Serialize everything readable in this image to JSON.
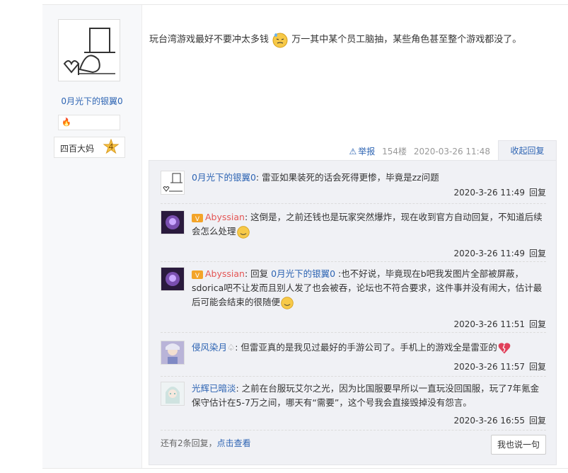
{
  "author": {
    "name": "0月光下的银翼0",
    "level_title": "四百大妈",
    "level_num": "4"
  },
  "post": {
    "text_before": "玩台湾游戏最好不要冲太多钱",
    "text_after": "万一其中某个员工脑抽，某些角色甚至整个游戏都没了。"
  },
  "tail": {
    "report": "举报",
    "floor": "154楼",
    "time": "2020-03-26 11:48",
    "collapse": "收起回复"
  },
  "replies": [
    {
      "user": "0月光下的银翼0",
      "text": ": 雷亚如果装死的话会死得更惨，毕竟是zz问题",
      "time": "2020-3-26 11:49",
      "reply": "回复"
    },
    {
      "user": "Abyssian",
      "text": ": 这倒是，之前还钱也是玩家突然爆炸，现在收到官方自动回复，不知道后续会怎么处理",
      "time": "2020-3-26 11:49",
      "reply": "回复"
    },
    {
      "user": "Abyssian",
      "reply_prefix": ": 回复 ",
      "reply_to": "0月光下的银翼0",
      "text": " :也不好说，毕竟现在b吧我发图片全部被屏蔽，sdorica吧不让发而且别人发了也会被吞，论坛也不符合要求，这件事并没有闹大，估计最后可能会结束的很随便",
      "time": "2020-3-26 11:51",
      "reply": "回复"
    },
    {
      "user": "侵风染月",
      "user_suffix": "♤",
      "text": ": 但雷亚真的是我见过最好的手游公司了。手机上的游戏全是雷亚的",
      "time": "2020-3-26 11:57",
      "reply": "回复"
    },
    {
      "user": "光辉已暗淡",
      "text": ": 之前在台服玩艾尔之光，因为比国服要早所以一直玩没回国服，玩了7年氪金保守估计在5-7万之间，哪天有“需要”，这个号我会直接毁掉没有怨言。",
      "time": "2020-3-26 16:55",
      "reply": "回复"
    }
  ],
  "footer": {
    "more_prefix": "还有2条回复，",
    "more_link": "点击查看",
    "reply_button": "我也说一句"
  },
  "colors": {
    "link": "#2d64b3",
    "vip_name": "#e45554",
    "panel_bg": "#f0f1f5"
  }
}
